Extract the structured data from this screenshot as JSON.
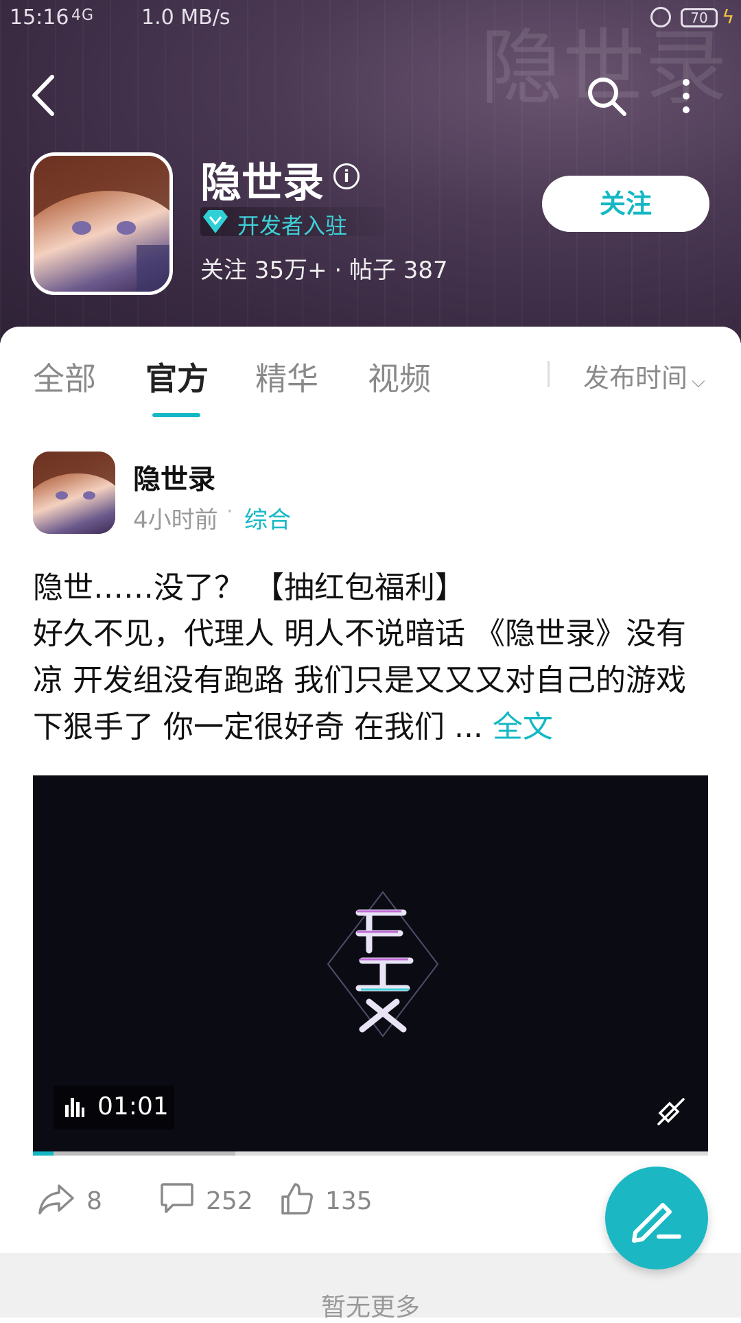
{
  "status_bar": {
    "time": "15:16",
    "signal": "4G",
    "speed": "1.0 MB/s",
    "battery": "70"
  },
  "header": {
    "bg_title": "隐世录",
    "app_name": "隐世录",
    "dev_badge": "开发者入驻",
    "stats": "关注 35万+ · 帖子 387",
    "follow_label": "关注"
  },
  "tabs": [
    {
      "label": "全部"
    },
    {
      "label": "官方",
      "active": true
    },
    {
      "label": "精华"
    },
    {
      "label": "视频"
    }
  ],
  "sort_label": "发布时间",
  "post": {
    "author": "隐世录",
    "time": "4小时前",
    "dot": "·",
    "category": "综合",
    "title": "隐世……没了？ 【抽红包福利】",
    "body": "好久不见，代理人 明人不说暗话 《隐世录》没有凉 开发组没有跑路 我们只是又又又对自己的游戏下狠手了 你一定很好奇 在我们 ... ",
    "more_label": "全文",
    "video": {
      "duration": "01:01",
      "played_fraction": 0.03,
      "buffered_fraction": 0.3
    },
    "share_count": "8",
    "comment_count": "252",
    "like_count": "135"
  },
  "footer_text": "暂无更多",
  "colors": {
    "accent": "#14b8c4",
    "header_bg": "#4c3a55",
    "fab": "#1bb8c3"
  }
}
